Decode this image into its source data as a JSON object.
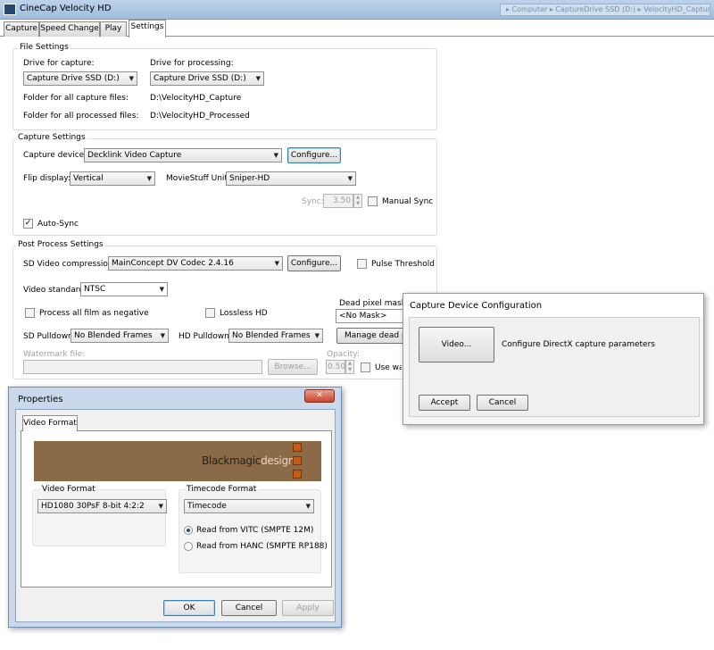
{
  "window": {
    "title": "CineCap Velocity HD",
    "blurred_bar": "▸ Computer ▸ CaptureDrive SSD (D:) ▸ VelocityHD_Capture"
  },
  "tabs": [
    {
      "label": "Capture"
    },
    {
      "label": "Speed Change"
    },
    {
      "label": "Play"
    },
    {
      "label": "Settings"
    }
  ],
  "file_settings": {
    "title": "File Settings",
    "drive_capture_label": "Drive for capture:",
    "drive_capture_value": "Capture Drive SSD (D:)",
    "drive_processing_label": "Drive for processing:",
    "drive_processing_value": "Capture Drive SSD (D:)",
    "capture_folder_label": "Folder for all capture files:",
    "capture_folder_value": "D:\\VelocityHD_Capture",
    "processed_folder_label": "Folder for all processed files:",
    "processed_folder_value": "D:\\VelocityHD_Processed"
  },
  "capture_settings": {
    "title": "Capture Settings",
    "device_label": "Capture device:",
    "device_value": "Decklink Video Capture",
    "configure_label": "Configure...",
    "flip_label": "Flip display:",
    "flip_value": "Vertical",
    "unit_label": "MovieStuff Unit:",
    "unit_value": "Sniper-HD",
    "sync_label": "Sync:",
    "sync_value": "3.50",
    "manual_sync_label": "Manual Sync",
    "auto_sync_label": "Auto-Sync",
    "auto_sync_checked": true
  },
  "post_process": {
    "title": "Post Process Settings",
    "compression_label": "SD Video compression:",
    "compression_value": "MainConcept DV Codec 2.4.16",
    "configure_label": "Configure...",
    "pulse_label": "Pulse Threshold",
    "standard_label": "Video standard:",
    "standard_value": "NTSC",
    "dead_pixel_label": "Dead pixel mask:",
    "dead_pixel_value": "<No Mask>",
    "negative_label": "Process all film as negative",
    "lossless_label": "Lossless HD",
    "sd_pulldown_label": "SD Pulldown:",
    "sd_pulldown_value": "No Blended Frames",
    "hd_pulldown_label": "HD Pulldown:",
    "hd_pulldown_value": "No Blended Frames",
    "manage_label": "Manage dead pixels",
    "watermark_label": "Watermark file:",
    "browse_label": "Browse...",
    "opacity_label": "Opacity:",
    "opacity_value": "0.50",
    "use_watermark_label": "Use watermark"
  },
  "capture_device_dialog": {
    "title": "Capture Device Configuration",
    "video_button": "Video...",
    "description": "Configure DirectX capture parameters",
    "accept": "Accept",
    "cancel": "Cancel"
  },
  "properties_dialog": {
    "title": "Properties",
    "close": "✕",
    "tab": "Video Format",
    "banner_text_bold": "Blackmagic",
    "banner_text_light": "design",
    "video_format_label": "Video Format",
    "video_format_value": "HD1080 30PsF 8-bit 4:2:2",
    "timecode_label": "Timecode Format",
    "timecode_value": "Timecode",
    "radio_vitc": "Read from VITC (SMPTE 12M)",
    "radio_hanc": "Read from HANC (SMPTE RP188)",
    "ok": "OK",
    "cancel": "Cancel",
    "apply": "Apply"
  },
  "colors": {
    "banner": "#8b6a48",
    "logo_squares": "#c45c16",
    "accent": "#3c7fb1"
  }
}
